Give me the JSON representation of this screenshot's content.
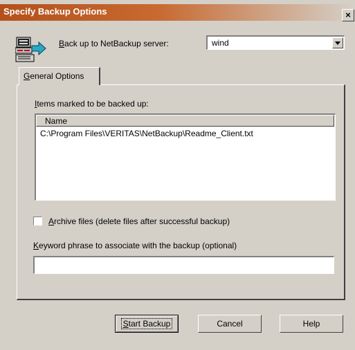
{
  "dialog": {
    "title": "Specify Backup Options",
    "close_label": "×"
  },
  "server": {
    "label_mnemonic": "B",
    "label_rest": "ack up to NetBackup server:",
    "value": "wind"
  },
  "tabs": [
    {
      "label_mnemonic": "G",
      "label_rest": "eneral Options"
    }
  ],
  "items": {
    "label_mnemonic": "I",
    "label_rest": "tems marked to be backed up:",
    "column_header": "Name",
    "rows": [
      "C:\\Program Files\\VERITAS\\NetBackup\\Readme_Client.txt"
    ]
  },
  "archive": {
    "label_mnemonic": "A",
    "label_rest": "rchive files (delete files after successful backup)",
    "checked": false
  },
  "keyword": {
    "label_mnemonic": "K",
    "label_rest": "eyword phrase to associate with the backup (optional)",
    "value": ""
  },
  "buttons": {
    "start_mnemonic": "S",
    "start_rest": "tart Backup",
    "cancel": "Cancel",
    "help": "Help"
  },
  "icons": [
    "computer-backup-icon",
    "dropdown-arrow-icon",
    "close-icon"
  ]
}
